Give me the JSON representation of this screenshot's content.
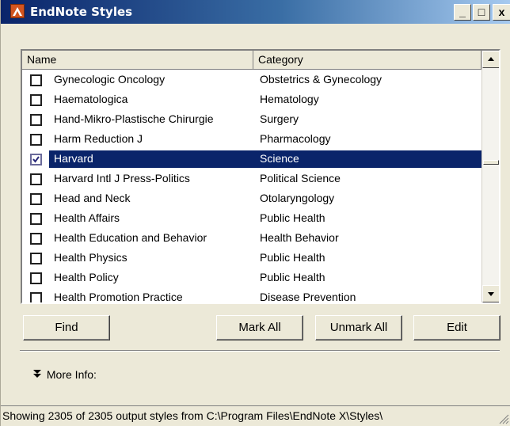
{
  "window": {
    "title": "EndNote Styles",
    "icon": "endnote-app-icon",
    "controls": {
      "minimize": "_",
      "maximize": "□",
      "close": "x"
    }
  },
  "list": {
    "columns": [
      "Name",
      "Category"
    ],
    "rows": [
      {
        "name": "Gynecologic Oncology",
        "category": "Obstetrics & Gynecology",
        "checked": false,
        "selected": false
      },
      {
        "name": "Haematologica",
        "category": "Hematology",
        "checked": false,
        "selected": false
      },
      {
        "name": "Hand-Mikro-Plastische Chirurgie",
        "category": "Surgery",
        "checked": false,
        "selected": false
      },
      {
        "name": "Harm Reduction J",
        "category": "Pharmacology",
        "checked": false,
        "selected": false
      },
      {
        "name": "Harvard",
        "category": "Science",
        "checked": true,
        "selected": true
      },
      {
        "name": "Harvard Intl J Press-Politics",
        "category": "Political Science",
        "checked": false,
        "selected": false
      },
      {
        "name": "Head and Neck",
        "category": "Otolaryngology",
        "checked": false,
        "selected": false
      },
      {
        "name": "Health Affairs",
        "category": "Public Health",
        "checked": false,
        "selected": false
      },
      {
        "name": "Health Education and Behavior",
        "category": "Health Behavior",
        "checked": false,
        "selected": false
      },
      {
        "name": "Health Physics",
        "category": "Public Health",
        "checked": false,
        "selected": false
      },
      {
        "name": "Health Policy",
        "category": "Public Health",
        "checked": false,
        "selected": false
      },
      {
        "name": "Health Promotion Practice",
        "category": "Disease Prevention",
        "checked": false,
        "selected": false
      }
    ]
  },
  "buttons": {
    "find": "Find",
    "mark_all": "Mark All",
    "unmark_all": "Unmark All",
    "edit": "Edit"
  },
  "more_info": {
    "label": "More Info:",
    "icon": "double-chevron-down-icon"
  },
  "status_bar": {
    "text": "Showing 2305 of 2305 output styles from C:\\Program Files\\EndNote X\\Styles\\"
  },
  "colors": {
    "titlebar": "#0a246a",
    "selection": "#0a246a",
    "face": "#ece9d8"
  }
}
